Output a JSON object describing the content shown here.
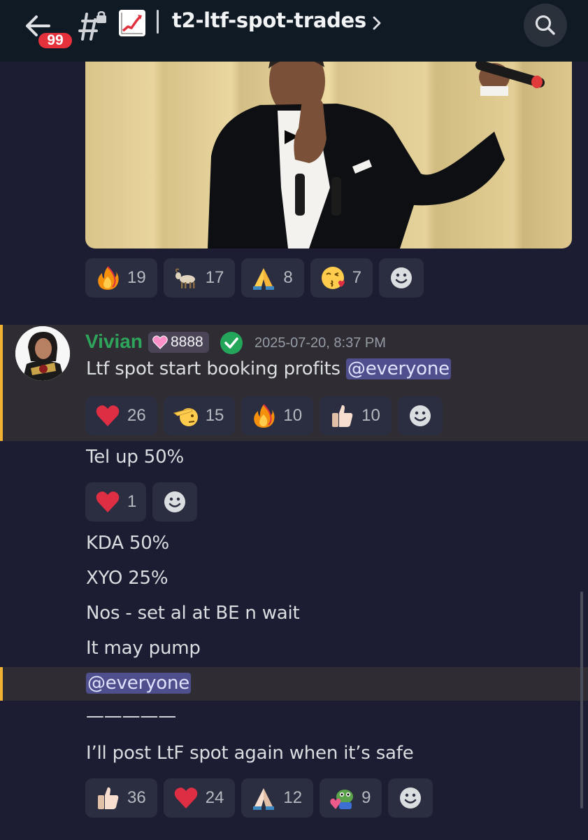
{
  "header": {
    "unread_count": "99",
    "channel_name": "t2-ltf-spot-trades",
    "icons": [
      "back-arrow-icon",
      "locked-hash-icon",
      "chart-increasing-icon",
      "chevron-right-icon",
      "search-icon"
    ]
  },
  "previous_message": {
    "attachment": "gif-image",
    "reactions": [
      {
        "emoji": "fire",
        "count": "19"
      },
      {
        "emoji": "goat",
        "count": "17"
      },
      {
        "emoji": "folded-hands",
        "count": "8"
      },
      {
        "emoji": "face-blowing-kiss",
        "count": "7"
      }
    ]
  },
  "message": {
    "author": "Vivian",
    "role_tag": "8888",
    "timestamp": "2025-07-20, 8:37 PM",
    "text_prefix": "Ltf spot start booking profits ",
    "mention": "@everyone",
    "reactions": [
      {
        "emoji": "red-heart",
        "count": "26"
      },
      {
        "emoji": "saluting-face",
        "count": "15"
      },
      {
        "emoji": "fire",
        "count": "10"
      },
      {
        "emoji": "thumbs-up",
        "count": "10"
      }
    ]
  },
  "followups": {
    "tel": "Tel up 50%",
    "tel_reactions": [
      {
        "emoji": "red-heart",
        "count": "1"
      }
    ],
    "kda": "KDA 50%",
    "xyo": "XYO 25%",
    "nos": "Nos - set al at BE n wait",
    "pump": "It may pump",
    "mention": "@everyone",
    "divider": "—————",
    "final": "I’ll post LtF spot again when it’s safe",
    "final_reactions": [
      {
        "emoji": "thumbs-up",
        "count": "36"
      },
      {
        "emoji": "red-heart",
        "count": "24"
      },
      {
        "emoji": "folded-hands",
        "count": "12"
      },
      {
        "emoji": "pepe-love",
        "count": "9"
      }
    ]
  },
  "colors": {
    "background": "#1c1d33",
    "header": "#101a25",
    "author": "#2ea55b",
    "highlight_bar": "#f0b232",
    "mention_bg": "#4e4f8c",
    "badge": "#e5313c"
  }
}
